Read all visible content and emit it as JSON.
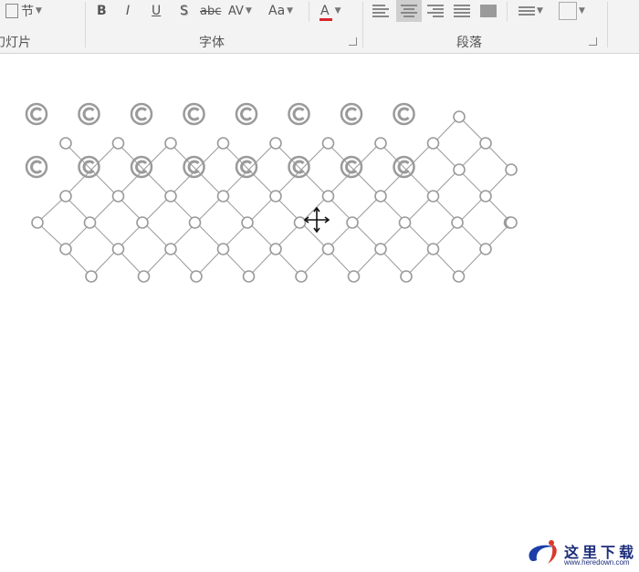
{
  "ribbon": {
    "slides_group": {
      "section_label": "节",
      "group_label": "幻灯片"
    },
    "font_group": {
      "bold_label": "B",
      "italic_label": "I",
      "underline_label": "U",
      "shadow_label": "S",
      "strikethrough_label": "abc",
      "spacing_label": "AV",
      "case_label": "Aa",
      "color_label": "A",
      "group_label": "字体"
    },
    "paragraph_group": {
      "group_label": "段落"
    }
  },
  "colors": {
    "font_color_bar": "#d9262c",
    "lattice_stroke": "#9a9a9a",
    "selection_highlight": "#cfcfcf"
  },
  "watermark": {
    "text": "这里下载",
    "url": "www.heredown.com"
  }
}
